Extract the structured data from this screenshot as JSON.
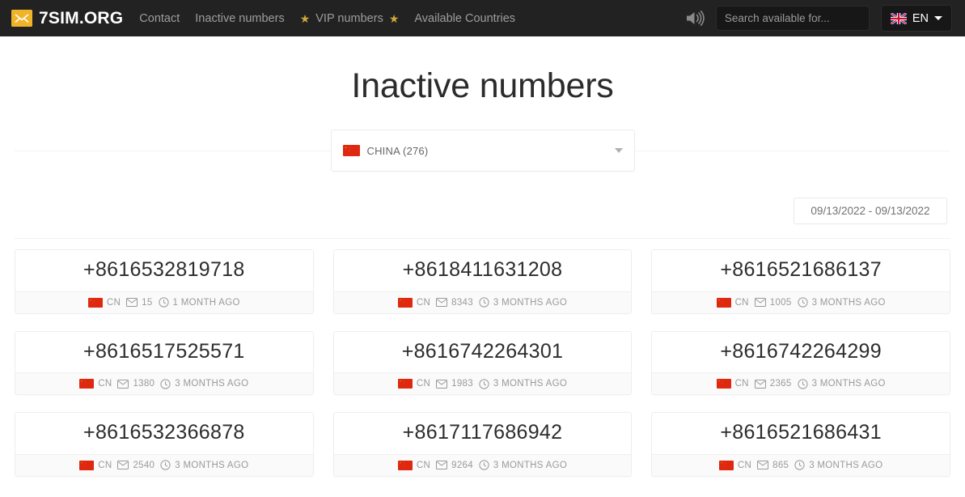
{
  "header": {
    "brand": {
      "icon": "envelope-icon",
      "text": "7SIM.ORG"
    },
    "nav": [
      {
        "label": "Contact",
        "name": "contact"
      },
      {
        "label": "Inactive numbers",
        "name": "inactive-numbers"
      },
      {
        "label": "VIP numbers",
        "name": "vip-numbers",
        "star": "★"
      },
      {
        "label": "Available Countries",
        "name": "available-countries"
      }
    ],
    "sound_icon": "speaker-icon",
    "search": {
      "placeholder": "Search available for...",
      "value": ""
    },
    "language": {
      "label": "EN",
      "flag": "uk-flag",
      "caret": "chevron-down-icon"
    }
  },
  "page": {
    "title": "Inactive numbers"
  },
  "filters": {
    "country": {
      "flag": "cn-flag",
      "label": "CHINA (276)",
      "caret": "chevron-down-icon"
    },
    "date_range": {
      "value": "09/13/2022 - 09/13/2022",
      "placeholder": "09/13/2022 - 09/13/2022"
    }
  },
  "colors": {
    "navbar_bg": "#222222",
    "brand_accent": "#f0b429",
    "star": "#d0a93c",
    "card_border": "#eeeeee",
    "card_footer_bg": "#fafafa",
    "meta_text": "#9a9a9a",
    "flag_red": "#de2910",
    "flag_yellow": "#ffde00"
  },
  "cards": [
    {
      "number": "+8616532819718",
      "country_code": "CN",
      "messages": "15",
      "age": "1 MONTH AGO"
    },
    {
      "number": "+8618411631208",
      "country_code": "CN",
      "messages": "8343",
      "age": "3 MONTHS AGO"
    },
    {
      "number": "+8616521686137",
      "country_code": "CN",
      "messages": "1005",
      "age": "3 MONTHS AGO"
    },
    {
      "number": "+8616517525571",
      "country_code": "CN",
      "messages": "1380",
      "age": "3 MONTHS AGO"
    },
    {
      "number": "+8616742264301",
      "country_code": "CN",
      "messages": "1983",
      "age": "3 MONTHS AGO"
    },
    {
      "number": "+8616742264299",
      "country_code": "CN",
      "messages": "2365",
      "age": "3 MONTHS AGO"
    },
    {
      "number": "+8616532366878",
      "country_code": "CN",
      "messages": "2540",
      "age": "3 MONTHS AGO"
    },
    {
      "number": "+8617117686942",
      "country_code": "CN",
      "messages": "9264",
      "age": "3 MONTHS AGO"
    },
    {
      "number": "+8616521686431",
      "country_code": "CN",
      "messages": "865",
      "age": "3 MONTHS AGO"
    }
  ]
}
